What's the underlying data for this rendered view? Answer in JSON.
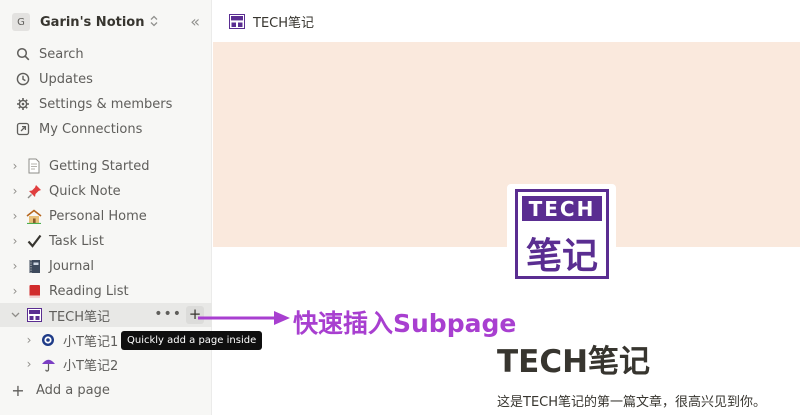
{
  "workspace": {
    "badge": "G",
    "name": "Garin's Notion",
    "switch_icon": "chevron-up-down-icon",
    "collapse_glyph": "«"
  },
  "nav": [
    {
      "label": "Search",
      "icon": "search-icon"
    },
    {
      "label": "Updates",
      "icon": "clock-icon"
    },
    {
      "label": "Settings & members",
      "icon": "gear-icon"
    },
    {
      "label": "My Connections",
      "icon": "connection-icon"
    }
  ],
  "pages": [
    {
      "label": "Getting Started",
      "icon": "document-icon"
    },
    {
      "label": "Quick Note",
      "icon": "pushpin-icon"
    },
    {
      "label": "Personal Home",
      "icon": "house-icon"
    },
    {
      "label": "Task List",
      "icon": "checkmark-icon"
    },
    {
      "label": "Journal",
      "icon": "notebook-icon"
    },
    {
      "label": "Reading List",
      "icon": "book-icon"
    },
    {
      "label": "TECH笔记",
      "icon": "tech-logo-icon",
      "active": true,
      "more": "•••",
      "add": "+"
    }
  ],
  "subpages": [
    {
      "label": "小T笔记1",
      "icon": "target-icon"
    },
    {
      "label": "小T笔记2",
      "icon": "umbrella-icon"
    }
  ],
  "tooltip": "Quickly add a page inside",
  "add_page": {
    "glyph": "+",
    "label": "Add a page"
  },
  "breadcrumb": {
    "title": "TECH笔记"
  },
  "logo": {
    "top_text": "TECH",
    "bottom_text": "笔记"
  },
  "page": {
    "title": "TECH笔记",
    "body": "这是TECH笔记的第一篇文章，很高兴见到你。"
  },
  "annotation": {
    "text": "快速插入Subpage"
  },
  "colors": {
    "brand_purple": "#5a2d91",
    "annotation_purple": "#a83fd0",
    "cover": "#fae9dd",
    "sidebar": "#f7f7f5"
  }
}
